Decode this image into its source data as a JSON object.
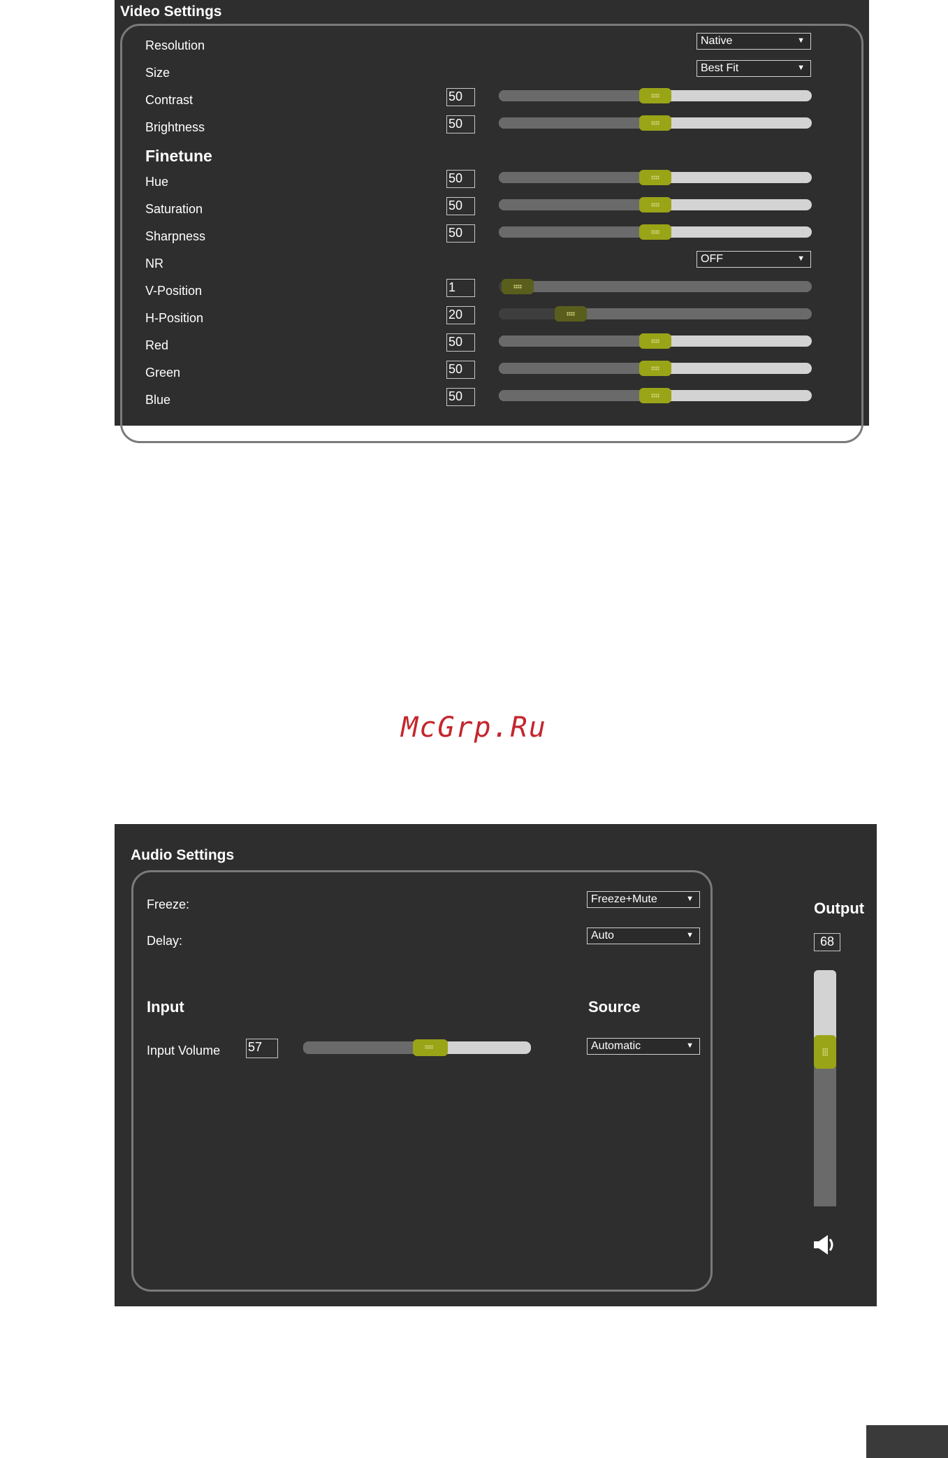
{
  "video": {
    "title": "Video Settings",
    "resolution": {
      "label": "Resolution",
      "value": "Native"
    },
    "size": {
      "label": "Size",
      "value": "Best Fit"
    },
    "contrast": {
      "label": "Contrast",
      "value": "50"
    },
    "brightness": {
      "label": "Brightness",
      "value": "50"
    },
    "finetune_heading": "Finetune",
    "hue": {
      "label": "Hue",
      "value": "50"
    },
    "saturation": {
      "label": "Saturation",
      "value": "50"
    },
    "sharpness": {
      "label": "Sharpness",
      "value": "50"
    },
    "nr": {
      "label": "NR",
      "value": "OFF"
    },
    "v_position": {
      "label": "V-Position",
      "value": "1"
    },
    "h_position": {
      "label": "H-Position",
      "value": "20"
    },
    "red": {
      "label": "Red",
      "value": "50"
    },
    "green": {
      "label": "Green",
      "value": "50"
    },
    "blue": {
      "label": "Blue",
      "value": "50"
    }
  },
  "audio": {
    "title": "Audio Settings",
    "freeze": {
      "label": "Freeze:",
      "value": "Freeze+Mute"
    },
    "delay": {
      "label": "Delay:",
      "value": "Auto"
    },
    "input_heading": "Input",
    "source_heading": "Source",
    "input_volume": {
      "label": "Input Volume",
      "value": "57"
    },
    "source": {
      "value": "Automatic"
    },
    "output_heading": "Output",
    "output_value": "68"
  },
  "icons": {
    "dropdown_arrow": "▼",
    "speaker": "speaker-icon"
  },
  "colors": {
    "panel_bg": "#2e2e2e",
    "accent_thumb": "#9aa417",
    "watermark": "#c4262e"
  },
  "watermark": "McGrp.Ru"
}
